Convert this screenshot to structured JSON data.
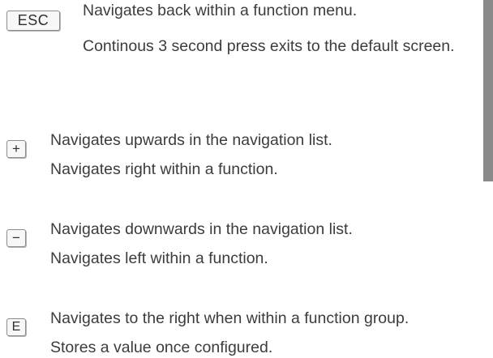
{
  "keys": {
    "esc": {
      "label": "ESC",
      "lines": [
        "Navigates back within a function menu.",
        "Continous 3 second press exits to the default screen."
      ]
    },
    "plus": {
      "label": "+",
      "lines": [
        "Navigates upwards in the navigation list.",
        "Navigates right within a function."
      ]
    },
    "minus": {
      "label": "−",
      "lines": [
        "Navigates downwards in the navigation list.",
        "Navigates left within a function."
      ]
    },
    "e": {
      "label": "E",
      "lines": [
        "Navigates to the right when within a function group.",
        "Stores a value once configured."
      ]
    }
  },
  "colors": {
    "text": "#3c3c3c",
    "key_border": "#8c8c8c",
    "edge_bar": "#8a8a8a"
  }
}
